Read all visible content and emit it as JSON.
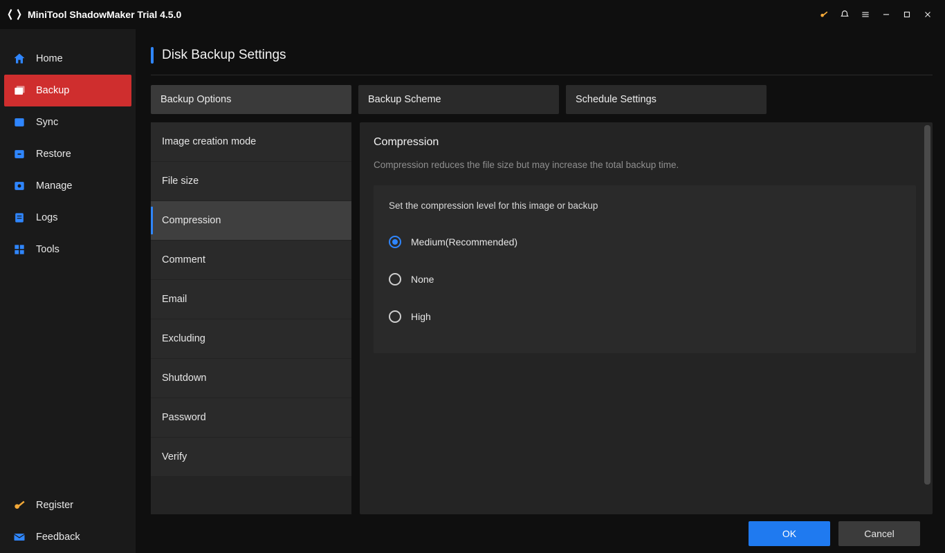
{
  "title": "MiniTool ShadowMaker Trial 4.5.0",
  "sidebar": {
    "items": [
      {
        "label": "Home"
      },
      {
        "label": "Backup"
      },
      {
        "label": "Sync"
      },
      {
        "label": "Restore"
      },
      {
        "label": "Manage"
      },
      {
        "label": "Logs"
      },
      {
        "label": "Tools"
      }
    ],
    "bottom": [
      {
        "label": "Register"
      },
      {
        "label": "Feedback"
      }
    ]
  },
  "page": {
    "title": "Disk Backup Settings"
  },
  "tabs": [
    {
      "label": "Backup Options"
    },
    {
      "label": "Backup Scheme"
    },
    {
      "label": "Schedule Settings"
    }
  ],
  "options": [
    {
      "label": "Image creation mode"
    },
    {
      "label": "File size"
    },
    {
      "label": "Compression"
    },
    {
      "label": "Comment"
    },
    {
      "label": "Email"
    },
    {
      "label": "Excluding"
    },
    {
      "label": "Shutdown"
    },
    {
      "label": "Password"
    },
    {
      "label": "Verify"
    }
  ],
  "panel": {
    "heading": "Compression",
    "description": "Compression reduces the file size but may increase the total backup time.",
    "subheading": "Set the compression level for this image or backup",
    "radios": [
      {
        "label": "Medium(Recommended)",
        "selected": true
      },
      {
        "label": "None",
        "selected": false
      },
      {
        "label": "High",
        "selected": false
      }
    ]
  },
  "footer": {
    "ok": "OK",
    "cancel": "Cancel"
  }
}
